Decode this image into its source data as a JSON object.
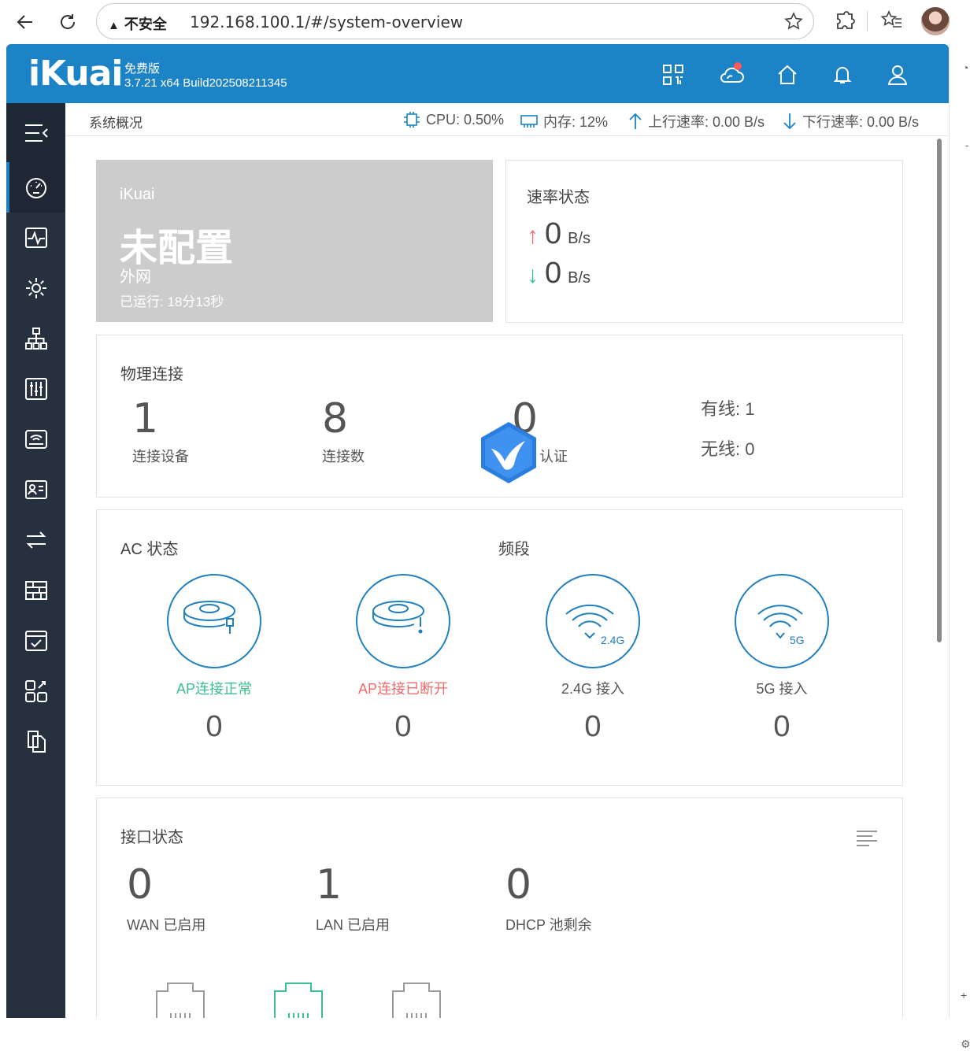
{
  "browser": {
    "security_label": "不安全",
    "url": "192.168.100.1/#/system-overview"
  },
  "header": {
    "logo": "iKuai",
    "edition": "免费版",
    "version": "3.7.21 x64 Build202508211345"
  },
  "statusbar": {
    "breadcrumb": "系统概况",
    "cpu": "CPU: 0.50%",
    "memory": "内存: 12%",
    "upload": "上行速率: 0.00 B/s",
    "download": "下行速率: 0.00 B/s"
  },
  "wan_card": {
    "brand": "iKuai",
    "status": "未配置",
    "name": "外网",
    "uptime": "已运行: 18分13秒"
  },
  "speed_card": {
    "title": "速率状态",
    "up_value": "0",
    "up_unit": "B/s",
    "down_value": "0",
    "down_unit": "B/s",
    "up_color": "#f26b6b",
    "down_color": "#3cbf8e"
  },
  "physical": {
    "title": "物理连接",
    "devices_value": "1",
    "devices_label": "连接设备",
    "connections_value": "8",
    "connections_label": "连接数",
    "auth_value": "0",
    "auth_label": "认证",
    "wired": "有线: 1",
    "wireless": "无线: 0"
  },
  "ac": {
    "title": "AC 状态",
    "band_title": "频段",
    "items": [
      {
        "label": "AP连接正常",
        "value": "0",
        "color": "#3cbf8e"
      },
      {
        "label": "AP连接已断开",
        "value": "0",
        "color": "#f26b6b"
      },
      {
        "label": "2.4G 接入",
        "value": "0",
        "color": "#555555",
        "badge": "2.4G"
      },
      {
        "label": "5G 接入",
        "value": "0",
        "color": "#555555",
        "badge": "5G"
      }
    ]
  },
  "interfaces": {
    "title": "接口状态",
    "wan_value": "0",
    "wan_label": "WAN 已启用",
    "lan_value": "1",
    "lan_label": "LAN 已启用",
    "dhcp_value": "0",
    "dhcp_label": "DHCP 池剩余"
  },
  "colors": {
    "brand": "#1c83c7",
    "sidebar": "#26303f"
  }
}
